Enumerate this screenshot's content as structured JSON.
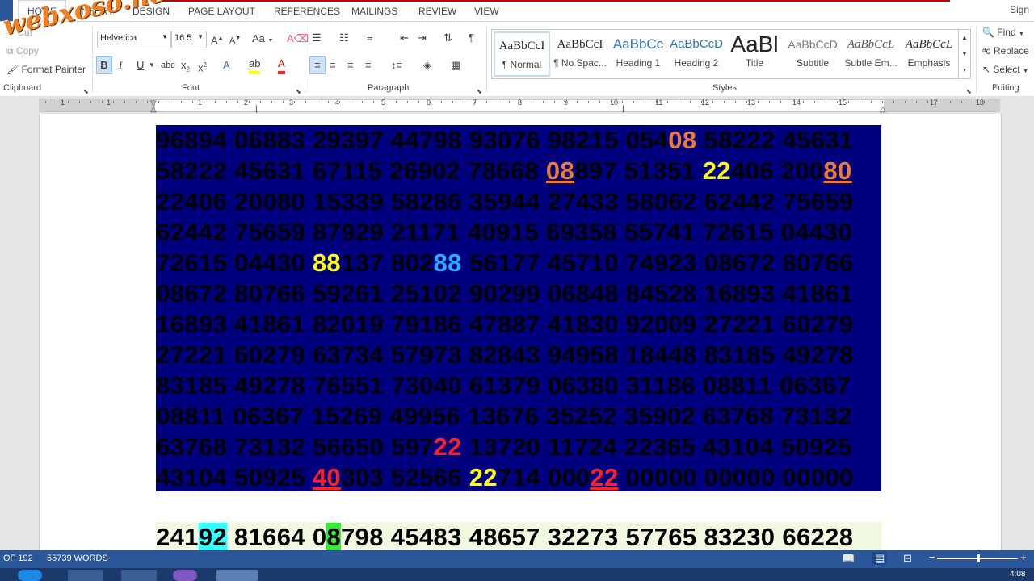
{
  "tabs": [
    "HOME",
    "INSERT",
    "DESIGN",
    "PAGE LAYOUT",
    "REFERENCES",
    "MAILINGS",
    "REVIEW",
    "VIEW"
  ],
  "signin": "Sign",
  "watermark": "webxoso.net",
  "clipboard": {
    "cut": "Cut",
    "copy": "Copy",
    "painter": "Format Painter",
    "label": "Clipboard"
  },
  "font": {
    "name": "Helvetica",
    "size": "16.5",
    "label": "Font",
    "case_btn": "Aa"
  },
  "paragraph": {
    "label": "Paragraph"
  },
  "styles": {
    "label": "Styles",
    "items": [
      {
        "preview": "AaBbCcI",
        "name": "¶ Normal"
      },
      {
        "preview": "AaBbCcI",
        "name": "¶ No Spac..."
      },
      {
        "preview": "AaBbCc",
        "name": "Heading 1"
      },
      {
        "preview": "AaBbCcD",
        "name": "Heading 2"
      },
      {
        "preview": "AaBl",
        "name": "Title"
      },
      {
        "preview": "AaBbCcD",
        "name": "Subtitle"
      },
      {
        "preview": "AaBbCcL",
        "name": "Subtle Em..."
      },
      {
        "preview": "AaBbCcL",
        "name": "Emphasis"
      }
    ]
  },
  "editing": {
    "find": "Find",
    "replace": "Replace",
    "select": "Select",
    "label": "Editing"
  },
  "ruler_numbers": [
    "2",
    "1",
    "1",
    "1",
    "2",
    "3",
    "4",
    "5",
    "6",
    "7",
    "8",
    "9",
    "10",
    "11",
    "12",
    "13",
    "14",
    "15",
    "17",
    "18"
  ],
  "rows": [
    [
      {
        "t": "96894 06883 29397 44798 93076 98215 054"
      },
      {
        "t": "08",
        "c": "hl-orange"
      },
      {
        "t": " 58222 45631"
      }
    ],
    [
      {
        "t": "58222 45631 67115 26902 78668 "
      },
      {
        "t": "08",
        "c": "hl-orange-u"
      },
      {
        "t": "897 51351 "
      },
      {
        "t": "22",
        "c": "hl-yellow"
      },
      {
        "t": "406 200"
      },
      {
        "t": "80",
        "c": "hl-orange-u"
      }
    ],
    [
      {
        "t": "22406 20080 15339 58286 35944 27433 58062 62442 75659"
      }
    ],
    [
      {
        "t": "62442 75659 87929 21171 40915 69358 55741 72615 04430"
      }
    ],
    [
      {
        "t": "72615 04430 "
      },
      {
        "t": "88",
        "c": "hl-yellow"
      },
      {
        "t": "137 802"
      },
      {
        "t": "88",
        "c": "hl-blue"
      },
      {
        "t": " 56177 45710 74923 08672 80766"
      }
    ],
    [
      {
        "t": "08672 80766 59261 25102 90299 06848 84528 16893 41861"
      }
    ],
    [
      {
        "t": "16893 41861 82019 79186 47887 41830 92009 27221 60279"
      }
    ],
    [
      {
        "t": "27221 60279 63734 57973 82843 94958 18448 83185 49278"
      }
    ],
    [
      {
        "t": "83185 49278 76551 73040 61379 06380 31186 08811 06367"
      }
    ],
    [
      {
        "t": "08811 06367 15269 49956 13676 35252 35902 63768 73132"
      }
    ],
    [
      {
        "t": "63768 73132 56650 597"
      },
      {
        "t": "22",
        "c": "hl-red"
      },
      {
        "t": " 13720 11724 22365 43104 50925"
      }
    ],
    [
      {
        "t": "43104 50925 "
      },
      {
        "t": "40",
        "c": "hl-red-u"
      },
      {
        "t": "303 52566 "
      },
      {
        "t": "22",
        "c": "hl-yellow"
      },
      {
        "t": "714 000"
      },
      {
        "t": "22",
        "c": "hl-red-u"
      },
      {
        "t": " 00000 00000 00000"
      }
    ]
  ],
  "last_line": [
    {
      "t": "241"
    },
    {
      "t": "92",
      "c": "bg-cyan"
    },
    {
      "t": " 81664 0"
    },
    {
      "t": "8",
      "c": "bg-green"
    },
    {
      "t": "798 45483 48657 32273 57765 83230 66228"
    }
  ],
  "status": {
    "pages": "OF 192",
    "words": "55739 WORDS"
  },
  "clock": "4:08"
}
